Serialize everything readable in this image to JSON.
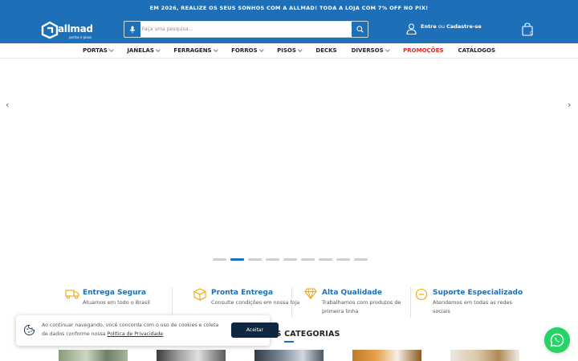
{
  "topbar": {
    "text": "EM 2026, REALIZE OS SEUS SONHOS COM A ALLMAD! TODA A LOJA COM 7% OFF NO PIX!"
  },
  "header": {
    "logo_text": "allmad",
    "logo_sub": "portas e pisos",
    "search_placeholder": "Faça uma pesquisa...",
    "account": {
      "login": "Entre",
      "or": "ou",
      "signup": "Cadastre-se"
    },
    "cart_count": "0"
  },
  "nav": {
    "items": [
      {
        "label": "PORTAS",
        "dropdown": true
      },
      {
        "label": "JANELAS",
        "dropdown": true
      },
      {
        "label": "FERRAGENS",
        "dropdown": true
      },
      {
        "label": "FORROS",
        "dropdown": true
      },
      {
        "label": "PISOS",
        "dropdown": true
      },
      {
        "label": "DECKS",
        "dropdown": false
      },
      {
        "label": "DIVERSOS",
        "dropdown": true
      },
      {
        "label": "PROMOÇÕES",
        "dropdown": false
      },
      {
        "label": "CATÁLOGOS",
        "dropdown": false
      }
    ]
  },
  "carousel": {
    "prev": "‹",
    "next": "›",
    "slide_count": 9,
    "active_index": 1
  },
  "features": [
    {
      "title": "Entrega Segura",
      "desc": "Atuamos em todo o Brasil",
      "icon": "truck-icon"
    },
    {
      "title": "Pronta Entrega",
      "desc": "Consulte condições em nossa loja",
      "icon": "box-icon"
    },
    {
      "title": "Alta Qualidade",
      "desc": "Trabalhamos com produtos de primeira linha",
      "icon": "diamond-icon"
    },
    {
      "title": "Suporte Especializado",
      "desc": "Atendemos em todas as redes sociais",
      "icon": "support-icon"
    }
  ],
  "categories": {
    "title": "AS CATEGORIAS"
  },
  "cookie": {
    "text": "Ao continuar navegando, você concorda com o uso de cookies e coleta de dados conforme nossa",
    "link": "Política de Privacidade",
    "button": "Aceitar"
  },
  "colors": {
    "brand": "#1d6fb8",
    "promo": "#d62b2b",
    "accent_icon": "#f0a500",
    "whatsapp": "#25d366",
    "cookie_button": "#0f2740"
  }
}
